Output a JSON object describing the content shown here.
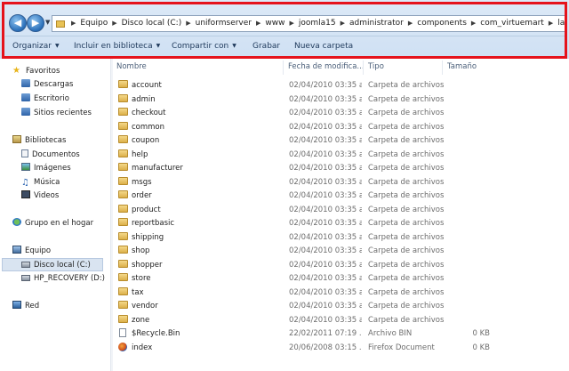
{
  "address_path": [
    "Equipo",
    "Disco local (C:)",
    "uniformserver",
    "www",
    "joomla15",
    "administrator",
    "components",
    "com_virtuemart",
    "languages"
  ],
  "toolbar": {
    "organize": "Organizar",
    "include_library": "Incluir en biblioteca",
    "share": "Compartir con",
    "burn": "Grabar",
    "new_folder": "Nueva carpeta"
  },
  "nav": {
    "favorites": "Favoritos",
    "downloads": "Descargas",
    "desktop": "Escritorio",
    "recent": "Sitios recientes",
    "libraries": "Bibliotecas",
    "documents": "Documentos",
    "images": "Imágenes",
    "music": "Música",
    "videos": "Videos",
    "homegroup": "Grupo en el hogar",
    "computer": "Equipo",
    "local_disk": "Disco local (C:)",
    "recovery": "HP_RECOVERY (D:)",
    "network": "Red"
  },
  "columns": {
    "name": "Nombre",
    "date": "Fecha de modifica...",
    "type": "Tipo",
    "size": "Tamaño"
  },
  "files": [
    {
      "name": "account",
      "date": "02/04/2010 03:35 a...",
      "type": "Carpeta de archivos",
      "size": "",
      "kind": "folder"
    },
    {
      "name": "admin",
      "date": "02/04/2010 03:35 a...",
      "type": "Carpeta de archivos",
      "size": "",
      "kind": "folder"
    },
    {
      "name": "checkout",
      "date": "02/04/2010 03:35 a...",
      "type": "Carpeta de archivos",
      "size": "",
      "kind": "folder"
    },
    {
      "name": "common",
      "date": "02/04/2010 03:35 a...",
      "type": "Carpeta de archivos",
      "size": "",
      "kind": "folder"
    },
    {
      "name": "coupon",
      "date": "02/04/2010 03:35 a...",
      "type": "Carpeta de archivos",
      "size": "",
      "kind": "folder"
    },
    {
      "name": "help",
      "date": "02/04/2010 03:35 a...",
      "type": "Carpeta de archivos",
      "size": "",
      "kind": "folder"
    },
    {
      "name": "manufacturer",
      "date": "02/04/2010 03:35 a...",
      "type": "Carpeta de archivos",
      "size": "",
      "kind": "folder"
    },
    {
      "name": "msgs",
      "date": "02/04/2010 03:35 a...",
      "type": "Carpeta de archivos",
      "size": "",
      "kind": "folder"
    },
    {
      "name": "order",
      "date": "02/04/2010 03:35 a...",
      "type": "Carpeta de archivos",
      "size": "",
      "kind": "folder"
    },
    {
      "name": "product",
      "date": "02/04/2010 03:35 a...",
      "type": "Carpeta de archivos",
      "size": "",
      "kind": "folder"
    },
    {
      "name": "reportbasic",
      "date": "02/04/2010 03:35 a...",
      "type": "Carpeta de archivos",
      "size": "",
      "kind": "folder"
    },
    {
      "name": "shipping",
      "date": "02/04/2010 03:35 a...",
      "type": "Carpeta de archivos",
      "size": "",
      "kind": "folder"
    },
    {
      "name": "shop",
      "date": "02/04/2010 03:35 a...",
      "type": "Carpeta de archivos",
      "size": "",
      "kind": "folder"
    },
    {
      "name": "shopper",
      "date": "02/04/2010 03:35 a...",
      "type": "Carpeta de archivos",
      "size": "",
      "kind": "folder"
    },
    {
      "name": "store",
      "date": "02/04/2010 03:35 a...",
      "type": "Carpeta de archivos",
      "size": "",
      "kind": "folder"
    },
    {
      "name": "tax",
      "date": "02/04/2010 03:35 a...",
      "type": "Carpeta de archivos",
      "size": "",
      "kind": "folder"
    },
    {
      "name": "vendor",
      "date": "02/04/2010 03:35 a...",
      "type": "Carpeta de archivos",
      "size": "",
      "kind": "folder"
    },
    {
      "name": "zone",
      "date": "02/04/2010 03:35 a...",
      "type": "Carpeta de archivos",
      "size": "",
      "kind": "folder"
    },
    {
      "name": "$Recycle.Bin",
      "date": "22/02/2011 07:19 ...",
      "type": "Archivo BIN",
      "size": "0 KB",
      "kind": "file"
    },
    {
      "name": "index",
      "date": "20/06/2008 03:15 ...",
      "type": "Firefox Document",
      "size": "0 KB",
      "kind": "firefox"
    }
  ],
  "colors": {
    "highlight": "#e5131c",
    "chrome": "#dce9f7",
    "selection": "#d9e4f1"
  }
}
